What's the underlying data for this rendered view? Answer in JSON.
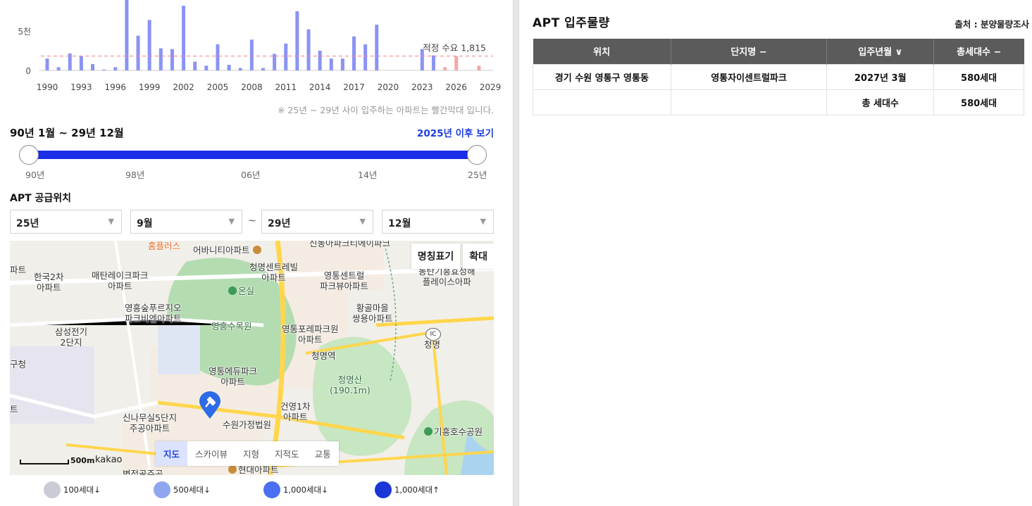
{
  "chart_data": {
    "type": "bar",
    "x": [
      1990,
      1991,
      1992,
      1993,
      1994,
      1995,
      1996,
      1997,
      1998,
      1999,
      2000,
      2001,
      2002,
      2003,
      2004,
      2005,
      2006,
      2007,
      2008,
      2009,
      2010,
      2011,
      2012,
      2013,
      2014,
      2015,
      2016,
      2017,
      2018,
      2019,
      2020,
      2021,
      2022,
      2023,
      2024,
      2025,
      2026,
      2027,
      2028,
      2029
    ],
    "values": [
      1500,
      400,
      2150,
      1800,
      800,
      100,
      400,
      9000,
      4400,
      6400,
      2800,
      2700,
      8200,
      1100,
      600,
      3300,
      700,
      300,
      3900,
      300,
      2100,
      3400,
      7500,
      5200,
      2500,
      1500,
      1500,
      4300,
      3300,
      5800,
      0,
      0,
      0,
      2700,
      1900,
      400,
      1800,
      0,
      600,
      0
    ],
    "highlight_from": 2025,
    "bar_color": "#8b93f3",
    "highlight_color": "#f5a8a8",
    "ytick_labels": [
      "0",
      "5천"
    ],
    "xtick_labels": [
      "1990",
      "1993",
      "1996",
      "1999",
      "2002",
      "2005",
      "2008",
      "2011",
      "2014",
      "2017",
      "2020",
      "2023",
      "2026",
      "2029"
    ],
    "reference": {
      "label": "적정 수요",
      "value": 1815,
      "value_text": "1,815",
      "color": "#f08c8c"
    },
    "ylim": [
      0,
      9000
    ]
  },
  "chart_note": "※ 25년 ~ 29년 사이 입주하는 아파트는 빨간막대 입니다.",
  "range": {
    "title": "90년 1월 ~ 29년 12월",
    "link": "2025년 이후 보기",
    "track_color": "#1a2ee8",
    "labels": [
      "90년",
      "98년",
      "06년",
      "14년",
      "25년"
    ]
  },
  "supply": {
    "title": "APT 공급위치",
    "from_year": "25년",
    "from_month": "9월",
    "tilde": "~",
    "to_year": "29년",
    "to_month": "12월",
    "arrow": "▼"
  },
  "map": {
    "btn_names": "명칭표기",
    "btn_expand": "확대",
    "tabs": [
      "지도",
      "스카이뷰",
      "지형",
      "지적도",
      "교통"
    ],
    "scale": "500m",
    "brand": "kakao",
    "labels": {
      "homeplus": "홈플러스",
      "community": "어바니티아파트",
      "top_cut": "신동아파크티에이파크",
      "cheongmyeong_central": "청명센트레빌\n아파트",
      "yeongtong_central": "영통센트럴\n파크뷰아파트",
      "place": "동탄기흥효성해\n플레이스아파",
      "apt_left": "파트",
      "hankook": "한국2차\n아파트",
      "metanlake": "매탄레이크파크\n아파트",
      "onsil": "온실",
      "forest": "영흥숲푸르지오\n파크비엔아파트",
      "arboretum": "영흥수목원",
      "hwanggol": "황골마을\n쌍용아파트",
      "samsung": "삼성전기\n2단지",
      "yeongtong_pori": "영통포레파크원\n아파트",
      "ic": "IC",
      "cheongmyeong_ic": "청명",
      "gucheong": "구청",
      "cheongmyeong_stn": "청명역",
      "edupark": "영통에듀파크\n아파트",
      "mountain": "청명산\n(190.1m)",
      "left_edge": "트",
      "geonyoung": "건영1차\n아파트",
      "sinnamusil": "신나무실5단지\n주공아파트",
      "court": "수원가정법원",
      "giheung": "기흥호수공원",
      "hyundai": "현대아파트",
      "bottom_cut": "벽적골주공"
    }
  },
  "legend": [
    {
      "label": "100세대↓",
      "color": "#c9ccd6"
    },
    {
      "label": "500세대↓",
      "color": "#8fa6ef"
    },
    {
      "label": "1,000세대↓",
      "color": "#4a6ff0"
    },
    {
      "label": "1,000세대↑",
      "color": "#1b36d6"
    }
  ],
  "apt_table": {
    "title": "APT 입주물량",
    "source": "출처 : 분양물량조사",
    "headers": [
      "위치",
      "단지명 −",
      "입주년월 ∨",
      "총세대수 −"
    ],
    "rows": [
      [
        "경기 수원 영통구 영통동",
        "영통자이센트럴파크",
        "2027년 3월",
        "580세대"
      ]
    ],
    "total": {
      "label": "총 세대수",
      "value": "580세대"
    }
  }
}
